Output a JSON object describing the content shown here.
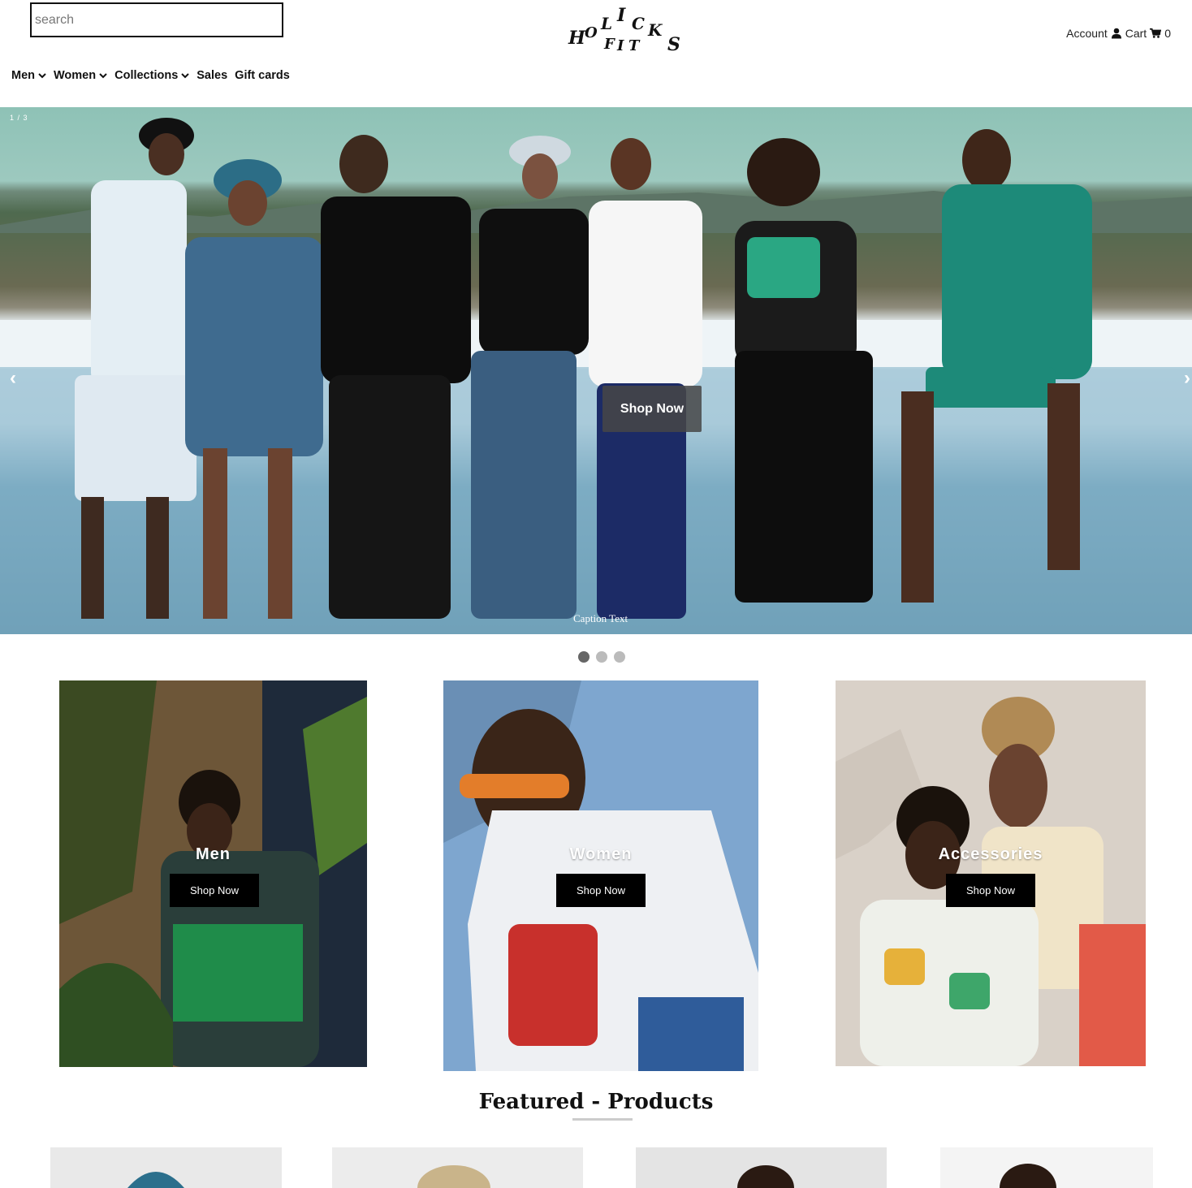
{
  "header": {
    "search_placeholder": "search",
    "logo_text": "HOLICKS FITS",
    "account_label": "Account",
    "cart_label": "Cart",
    "cart_count": "0"
  },
  "nav": {
    "items": [
      {
        "label": "Men",
        "has_dropdown": true
      },
      {
        "label": "Women",
        "has_dropdown": true
      },
      {
        "label": "Collections",
        "has_dropdown": true
      },
      {
        "label": "Sales",
        "has_dropdown": false
      },
      {
        "label": "Gift cards",
        "has_dropdown": false
      }
    ]
  },
  "hero": {
    "counter": "1 / 3",
    "cta_label": "Shop Now",
    "caption": "Caption Text",
    "prev_arrow": "‹",
    "next_arrow": "›",
    "slides_count": 3,
    "active_slide": 1
  },
  "categories": [
    {
      "title": "Men",
      "button": "Shop Now"
    },
    {
      "title": "Women",
      "button": "Shop Now"
    },
    {
      "title": "Accessories",
      "button": "Shop Now"
    }
  ],
  "featured": {
    "title": "Featured - Products"
  },
  "icons": {
    "account": "user-icon",
    "cart": "cart-icon",
    "dropdown": "chevron-down-icon"
  }
}
